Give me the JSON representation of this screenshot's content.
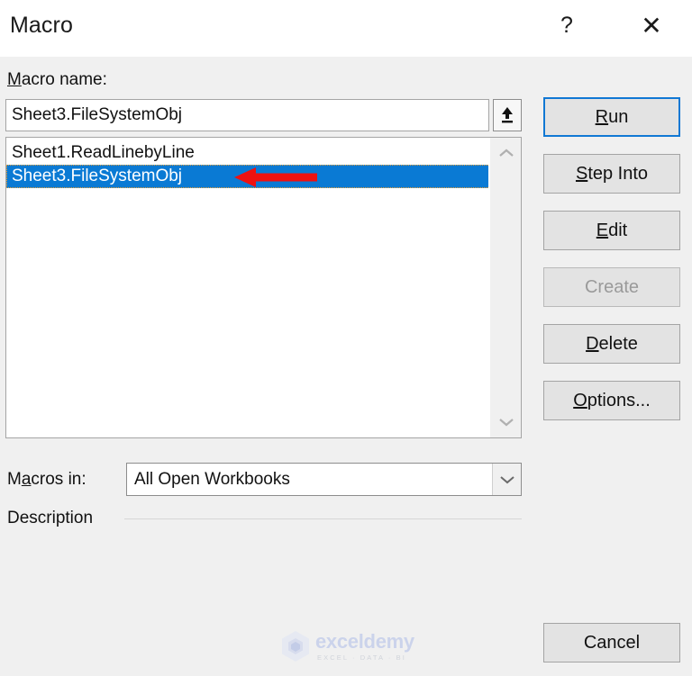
{
  "window": {
    "title": "Macro",
    "help_label": "?",
    "close_label": "✕"
  },
  "labels": {
    "macro_name": {
      "accel": "M",
      "rest": "acro name:"
    },
    "macros_in": {
      "pre": "M",
      "accel": "a",
      "rest": "cros in:"
    },
    "description": "Description"
  },
  "macro_name_field": {
    "value": "Sheet3.FileSystemObj",
    "placeholder": "",
    "upload_icon": "upload-arrow-icon"
  },
  "macro_list": {
    "items": [
      {
        "label": "Sheet1.ReadLinebyLine",
        "selected": false
      },
      {
        "label": "Sheet3.FileSystemObj",
        "selected": true
      }
    ],
    "scroll_up_icon": "chevron-up-icon",
    "scroll_down_icon": "chevron-down-icon"
  },
  "macros_in": {
    "value": "All Open Workbooks",
    "dropdown_icon": "chevron-down-icon"
  },
  "buttons": [
    {
      "id": "run",
      "accel": "R",
      "rest": "un",
      "pre": "",
      "state": "default"
    },
    {
      "id": "step-into",
      "accel": "S",
      "rest": "tep Into",
      "pre": "",
      "state": "normal"
    },
    {
      "id": "edit",
      "accel": "E",
      "rest": "dit",
      "pre": "",
      "state": "normal"
    },
    {
      "id": "create",
      "accel": "",
      "rest": "Create",
      "pre": "",
      "state": "disabled"
    },
    {
      "id": "delete",
      "accel": "D",
      "rest": "elete",
      "pre": "",
      "state": "normal"
    },
    {
      "id": "options",
      "accel": "O",
      "rest": "ptions...",
      "pre": "",
      "state": "normal"
    },
    {
      "id": "cancel",
      "accel": "",
      "rest": "Cancel",
      "pre": "",
      "state": "normal"
    }
  ],
  "button_labels": {
    "run": "Run",
    "step_into": "Step Into",
    "edit": "Edit",
    "create": "Create",
    "delete": "Delete",
    "options": "Options...",
    "cancel": "Cancel"
  },
  "annotation": {
    "type": "red-left-arrow",
    "color": "#ee1111",
    "points_to": "Sheet3.FileSystemObj"
  },
  "watermark": {
    "name": "exceldemy",
    "tagline": "EXCEL · DATA · BI",
    "logo_icon": "hexagon-cube-logo"
  },
  "colors": {
    "dialog_background": "#f0f0f0",
    "titlebar_background": "#ffffff",
    "selection_blue": "#0a7ad4",
    "focus_blue": "#1178d4",
    "focus_dotted": "#f0a030",
    "button_face": "#e3e3e3",
    "annotation_red": "#ee1111"
  }
}
